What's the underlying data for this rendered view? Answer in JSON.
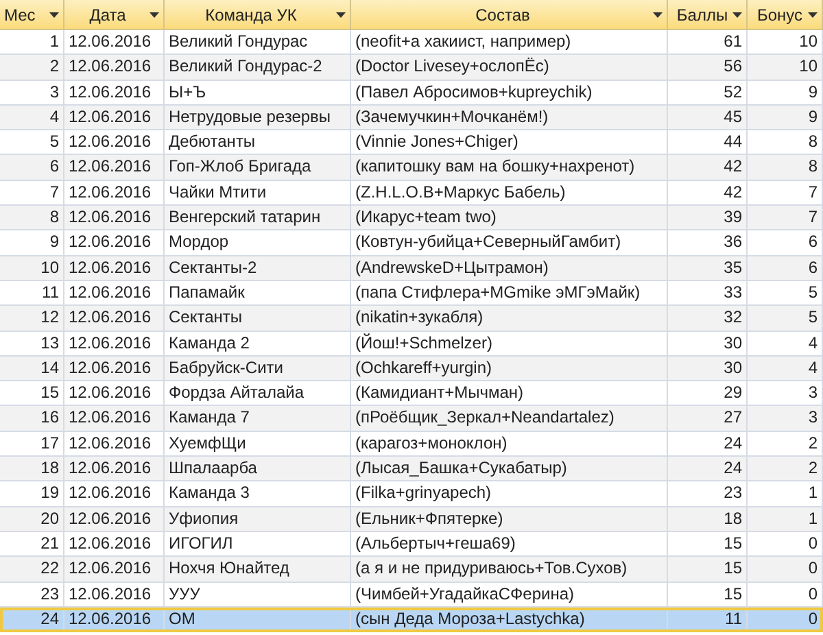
{
  "table": {
    "columns": [
      "Мес",
      "Дата",
      "Команда УК",
      "Состав",
      "Баллы",
      "Бонус"
    ],
    "rows": [
      {
        "cells": [
          "1",
          "12.06.2016",
          "Великий Гондурас",
          "(neofit+а хакиист, например)",
          "61",
          "10"
        ],
        "selected": false
      },
      {
        "cells": [
          "2",
          "12.06.2016",
          "Великий Гондурас-2",
          "(Doctor Livesey+ослопЁс)",
          "56",
          "10"
        ],
        "selected": false
      },
      {
        "cells": [
          "3",
          "12.06.2016",
          "Ы+Ъ",
          "(Павел Абросимов+kupreychik)",
          "52",
          "9"
        ],
        "selected": false
      },
      {
        "cells": [
          "4",
          "12.06.2016",
          "Нетрудовые резервы",
          "(Зачемучкин+Мочканём!)",
          "45",
          "9"
        ],
        "selected": false
      },
      {
        "cells": [
          "5",
          "12.06.2016",
          "Дебютанты",
          "(Vinnie Jones+Chiger)",
          "44",
          "8"
        ],
        "selected": false
      },
      {
        "cells": [
          "6",
          "12.06.2016",
          "Гоп-Жлоб Бригада",
          "(капитошку вам на бошку+нахренот)",
          "42",
          "8"
        ],
        "selected": false
      },
      {
        "cells": [
          "7",
          "12.06.2016",
          "Чайки Мтити",
          "(Z.H.L.O.B+Маркус Бабель)",
          "42",
          "7"
        ],
        "selected": false
      },
      {
        "cells": [
          "8",
          "12.06.2016",
          "Венгерский татарин",
          "(Икарус+team two)",
          "39",
          "7"
        ],
        "selected": false
      },
      {
        "cells": [
          "9",
          "12.06.2016",
          "Мордор",
          "(Ковтун-убийца+СеверныйГамбит)",
          "36",
          "6"
        ],
        "selected": false
      },
      {
        "cells": [
          "10",
          "12.06.2016",
          "Сектанты-2",
          "(AndrewskeD+Цытрамон)",
          "35",
          "6"
        ],
        "selected": false
      },
      {
        "cells": [
          "11",
          "12.06.2016",
          "Папамайк",
          "(папа Стифлера+MGmike эМГэМайк)",
          "33",
          "5"
        ],
        "selected": false
      },
      {
        "cells": [
          "12",
          "12.06.2016",
          "Сектанты",
          "(nikatin+зукабля)",
          "32",
          "5"
        ],
        "selected": false
      },
      {
        "cells": [
          "13",
          "12.06.2016",
          "Каманда 2",
          "(Йош!+Schmelzer)",
          "30",
          "4"
        ],
        "selected": false
      },
      {
        "cells": [
          "14",
          "12.06.2016",
          "Бабруйск-Сити",
          "(Ochkareff+yurgin)",
          "30",
          "4"
        ],
        "selected": false
      },
      {
        "cells": [
          "15",
          "12.06.2016",
          "Фордза Айталайа",
          "(Камидиант+Мычман)",
          "29",
          "3"
        ],
        "selected": false
      },
      {
        "cells": [
          "16",
          "12.06.2016",
          "Каманда 7",
          "(пРоёбщик_Зеркал+Neandartalez)",
          "27",
          "3"
        ],
        "selected": false
      },
      {
        "cells": [
          "17",
          "12.06.2016",
          "ХуемфЩи",
          "(карагоз+моноклон)",
          "24",
          "2"
        ],
        "selected": false
      },
      {
        "cells": [
          "18",
          "12.06.2016",
          "Шпалаарба",
          "(Лысая_Башка+Сукабатыр)",
          "24",
          "2"
        ],
        "selected": false
      },
      {
        "cells": [
          "19",
          "12.06.2016",
          "Каманда 3",
          "(Filka+grinyapech)",
          "23",
          "1"
        ],
        "selected": false
      },
      {
        "cells": [
          "20",
          "12.06.2016",
          "Уфиопия",
          "(Ельник+Фпятерке)",
          "18",
          "1"
        ],
        "selected": false
      },
      {
        "cells": [
          "21",
          "12.06.2016",
          "ИГОГИЛ",
          "(Альбертыч+геша69)",
          "15",
          "0"
        ],
        "selected": false
      },
      {
        "cells": [
          "22",
          "12.06.2016",
          "Нохчя Юнайтед",
          "(а я и не придуриваюсь+Тов.Сухов)",
          "15",
          "0"
        ],
        "selected": false
      },
      {
        "cells": [
          "23",
          "12.06.2016",
          "УУУ",
          "(Чимбей+УгадайкаСФерина)",
          "15",
          "0"
        ],
        "selected": false
      },
      {
        "cells": [
          "24",
          "12.06.2016",
          "ОМ",
          "(сын Деда Мороза+Lastychka)",
          "11",
          "0"
        ],
        "selected": true
      }
    ]
  }
}
